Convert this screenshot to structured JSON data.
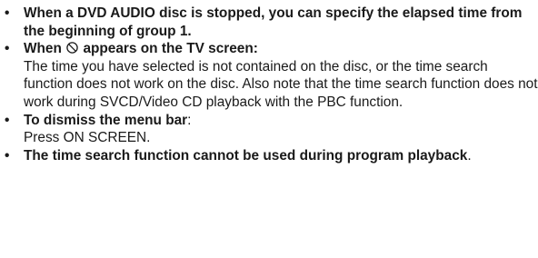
{
  "notes": [
    {
      "bold": "When a DVD AUDIO disc is stopped, you can specify the elapsed time from the beginning of group 1."
    },
    {
      "bold_pre": "When ",
      "icon": "prohibit-icon",
      "bold_post": " appears on the TV screen:",
      "body": "The time you have selected is not contained on the disc, or the time search function does not work on the disc. Also note that the time search function does not work during SVCD/Video CD playback with the PBC function."
    },
    {
      "bold": "To dismiss the menu bar",
      "colon": ":",
      "body": "Press ON SCREEN."
    },
    {
      "bold": "The time search function cannot be used during program playback",
      "period": "."
    }
  ]
}
